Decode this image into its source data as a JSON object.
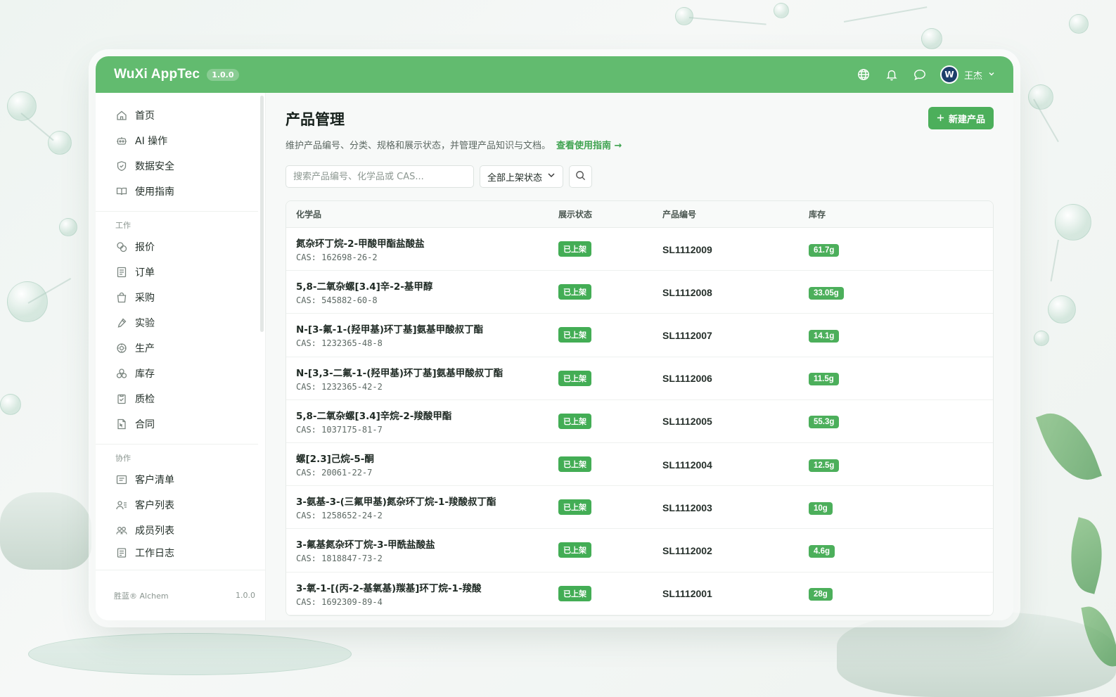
{
  "app": {
    "brand": "WuXi AppTec",
    "version": "1.0.0",
    "user_name": "王杰",
    "avatar_letter": "W"
  },
  "sidebar": {
    "top_items": [
      {
        "label": "首页",
        "icon": "home-icon"
      },
      {
        "label": "AI 操作",
        "icon": "robot-icon"
      },
      {
        "label": "数据安全",
        "icon": "shield-icon"
      },
      {
        "label": "使用指南",
        "icon": "book-icon"
      }
    ],
    "group_work": "工作",
    "work_items": [
      {
        "label": "报价",
        "icon": "coins-icon"
      },
      {
        "label": "订单",
        "icon": "order-icon"
      },
      {
        "label": "采购",
        "icon": "bag-icon"
      },
      {
        "label": "实验",
        "icon": "pipette-icon"
      },
      {
        "label": "生产",
        "icon": "gear-icon"
      },
      {
        "label": "库存",
        "icon": "boxes-icon"
      },
      {
        "label": "质检",
        "icon": "clipboard-check-icon"
      },
      {
        "label": "合同",
        "icon": "contract-icon"
      }
    ],
    "group_collab": "协作",
    "collab_items": [
      {
        "label": "客户清单",
        "icon": "list-icon"
      },
      {
        "label": "客户列表",
        "icon": "users-icon"
      },
      {
        "label": "成员列表",
        "icon": "members-icon"
      },
      {
        "label": "工作日志",
        "icon": "log-icon"
      }
    ],
    "footer_brand": "胜蓝® Alchem",
    "footer_version": "1.0.0"
  },
  "page": {
    "title": "产品管理",
    "description": "维护产品编号、分类、规格和展示状态，并管理产品知识与文档。",
    "guide_link": "查看使用指南 →",
    "new_button": "新建产品",
    "search_placeholder": "搜索产品编号、化学品或 CAS...",
    "status_filter": "全部上架状态"
  },
  "table": {
    "columns": [
      "化学品",
      "展示状态",
      "产品编号",
      "库存"
    ],
    "rows": [
      {
        "name": "氮杂环丁烷-2-甲酸甲酯盐酸盐",
        "cas": "CAS: 162698-26-2",
        "status": "已上架",
        "id": "SL1112009",
        "stock": "61.7g"
      },
      {
        "name": "5,8-二氧杂螺[3.4]辛-2-基甲醇",
        "cas": "CAS: 545882-60-8",
        "status": "已上架",
        "id": "SL1112008",
        "stock": "33.05g"
      },
      {
        "name": "N-[3-氟-1-(羟甲基)环丁基]氨基甲酸叔丁酯",
        "cas": "CAS: 1232365-48-8",
        "status": "已上架",
        "id": "SL1112007",
        "stock": "14.1g"
      },
      {
        "name": "N-[3,3-二氟-1-(羟甲基)环丁基]氨基甲酸叔丁酯",
        "cas": "CAS: 1232365-42-2",
        "status": "已上架",
        "id": "SL1112006",
        "stock": "11.5g"
      },
      {
        "name": "5,8-二氧杂螺[3.4]辛烷-2-羧酸甲酯",
        "cas": "CAS: 1037175-81-7",
        "status": "已上架",
        "id": "SL1112005",
        "stock": "55.3g"
      },
      {
        "name": "螺[2.3]己烷-5-酮",
        "cas": "CAS: 20061-22-7",
        "status": "已上架",
        "id": "SL1112004",
        "stock": "12.5g"
      },
      {
        "name": "3-氨基-3-(三氟甲基)氮杂环丁烷-1-羧酸叔丁酯",
        "cas": "CAS: 1258652-24-2",
        "status": "已上架",
        "id": "SL1112003",
        "stock": "10g"
      },
      {
        "name": "3-氟基氮杂环丁烷-3-甲酰盐酸盐",
        "cas": "CAS: 1818847-73-2",
        "status": "已上架",
        "id": "SL1112002",
        "stock": "4.6g"
      },
      {
        "name": "3-氧-1-[(丙-2-基氧基)羰基]环丁烷-1-羧酸",
        "cas": "CAS: 1692309-89-4",
        "status": "已上架",
        "id": "SL1112001",
        "stock": "28g"
      }
    ]
  },
  "colors": {
    "brand_green": "#62bb6f",
    "accent_green": "#4caf5b",
    "avatar_navy": "#1d3f6a"
  }
}
